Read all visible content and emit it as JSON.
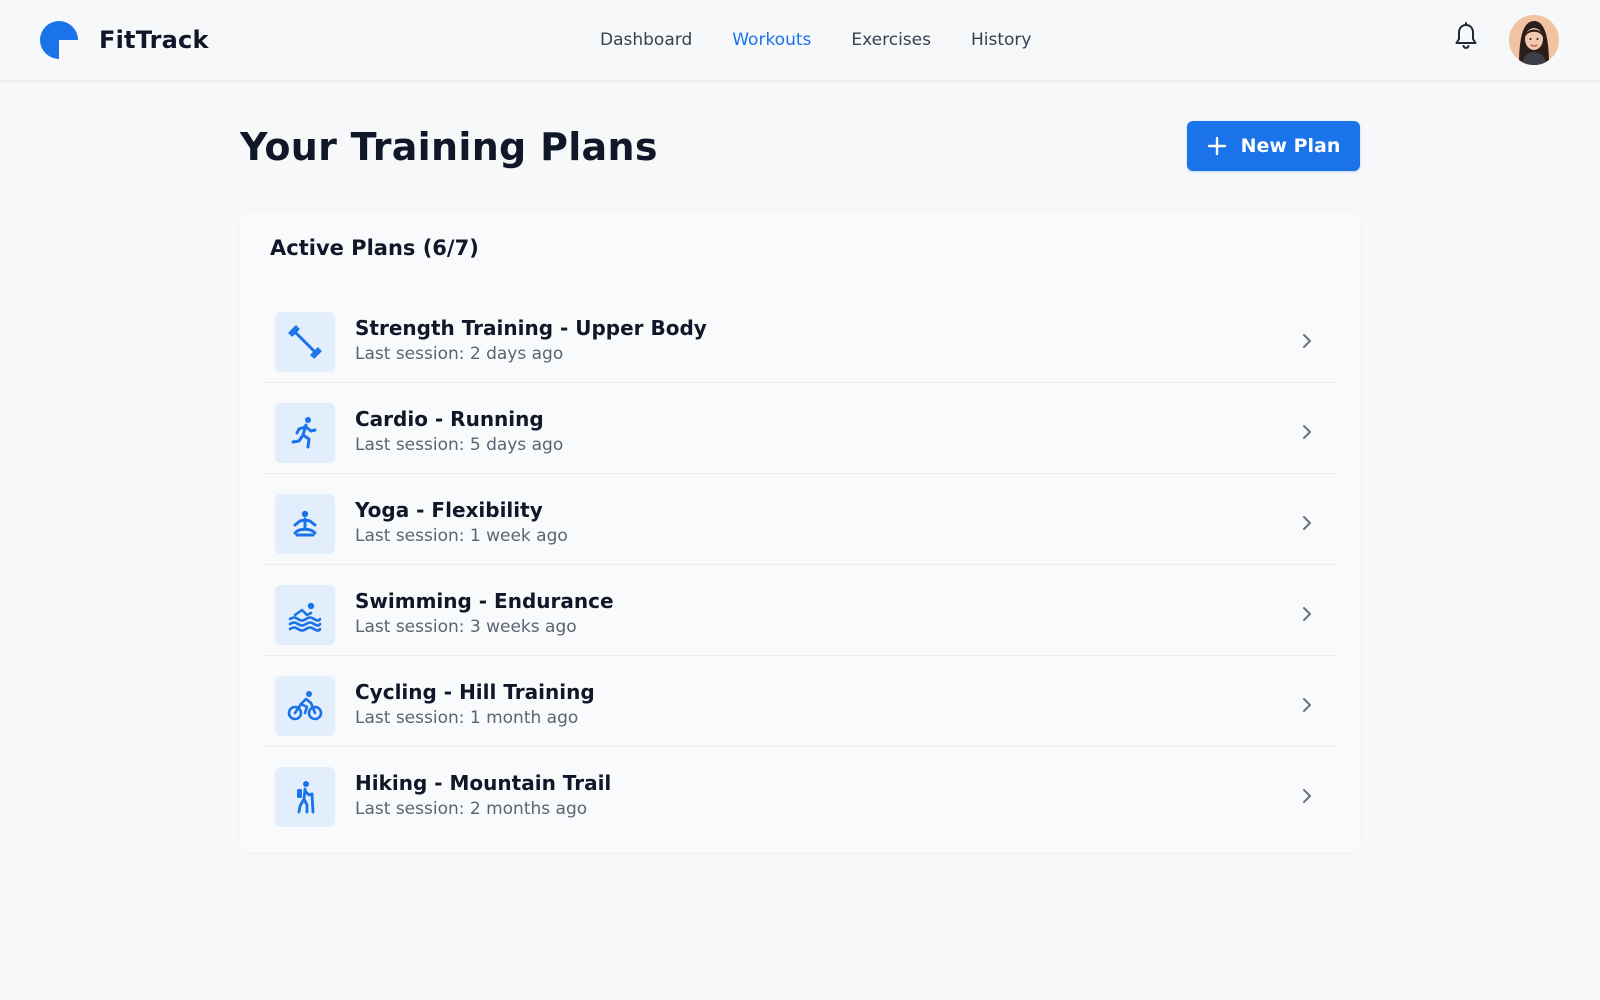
{
  "app": {
    "name": "FitTrack",
    "logo_icon": "fittrack-logo-icon",
    "accent_color": "#1a73e8"
  },
  "nav": {
    "items": [
      {
        "label": "Dashboard",
        "active": false
      },
      {
        "label": "Workouts",
        "active": true
      },
      {
        "label": "Exercises",
        "active": false
      },
      {
        "label": "History",
        "active": false
      }
    ]
  },
  "header": {
    "notification_icon": "bell-icon",
    "avatar_icon": "user-avatar"
  },
  "page": {
    "title": "Your Training Plans",
    "new_plan_label": "New Plan",
    "new_plan_icon": "plus-icon"
  },
  "card": {
    "title": "Active Plans (6/7)"
  },
  "plans": [
    {
      "name": "Strength Training - Upper Body",
      "last_session": "Last session: 2 days ago",
      "icon": "dumbbell-icon"
    },
    {
      "name": "Cardio - Running",
      "last_session": "Last session: 5 days ago",
      "icon": "running-icon"
    },
    {
      "name": "Yoga - Flexibility",
      "last_session": "Last session: 1 week ago",
      "icon": "yoga-icon"
    },
    {
      "name": "Swimming - Endurance",
      "last_session": "Last session: 3 weeks ago",
      "icon": "swimming-icon"
    },
    {
      "name": "Cycling - Hill Training",
      "last_session": "Last session: 1 month ago",
      "icon": "cycling-icon"
    },
    {
      "name": "Hiking - Mountain Trail",
      "last_session": "Last session: 2 months ago",
      "icon": "hiking-icon"
    }
  ]
}
